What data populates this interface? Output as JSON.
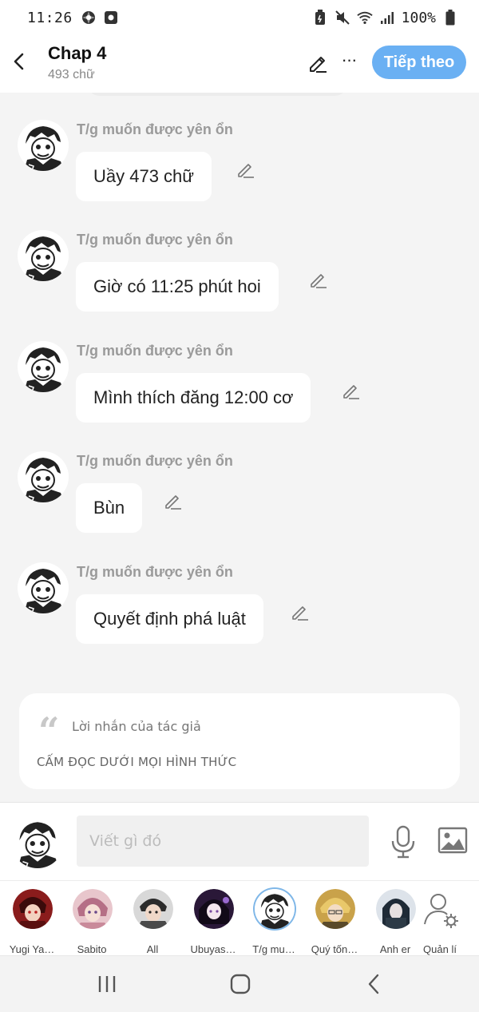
{
  "status_bar": {
    "time": "11:26",
    "battery_pct": "100%"
  },
  "header": {
    "title": "Chap 4",
    "subtitle": "493 chữ",
    "next_label": "Tiếp theo",
    "more_label": "···"
  },
  "messages": [
    {
      "sender": "T/g muốn được yên ổn",
      "text": "Uầy 473 chữ"
    },
    {
      "sender": "T/g muốn được yên ổn",
      "text": "Giờ có 11:25 phút hoi"
    },
    {
      "sender": "T/g muốn được yên ổn",
      "text": "Mình thích đăng 12:00 cơ"
    },
    {
      "sender": "T/g muốn được yên ổn",
      "text": "Bùn"
    },
    {
      "sender": "T/g muốn được yên ổn",
      "text": "Quyết định phá luật"
    }
  ],
  "author_note": {
    "label": "Lời nhắn của tác giả",
    "text": "CẤM ĐỌC DƯỚI MỌI HÌNH THỨC"
  },
  "composer": {
    "placeholder": "Viết gì đó"
  },
  "members": [
    {
      "name": "Yugi Ya…",
      "color": "#8a1c1c"
    },
    {
      "name": "Sabito",
      "color": "#c98a9a"
    },
    {
      "name": "All",
      "color": "#4a4a4a"
    },
    {
      "name": "Ubuyas…",
      "color": "#2a1838"
    },
    {
      "name": "T/g mu…",
      "color": "#ffffff"
    },
    {
      "name": "Quý tốn…",
      "color": "#d9b04a"
    },
    {
      "name": "Anh er",
      "color": "#2c3a46"
    },
    {
      "name": "Quản lí",
      "color": "#ffffff"
    }
  ],
  "colors": {
    "accent": "#6ab0f3",
    "sender_gray": "#9a9a9a",
    "background": "#f4f4f4"
  }
}
